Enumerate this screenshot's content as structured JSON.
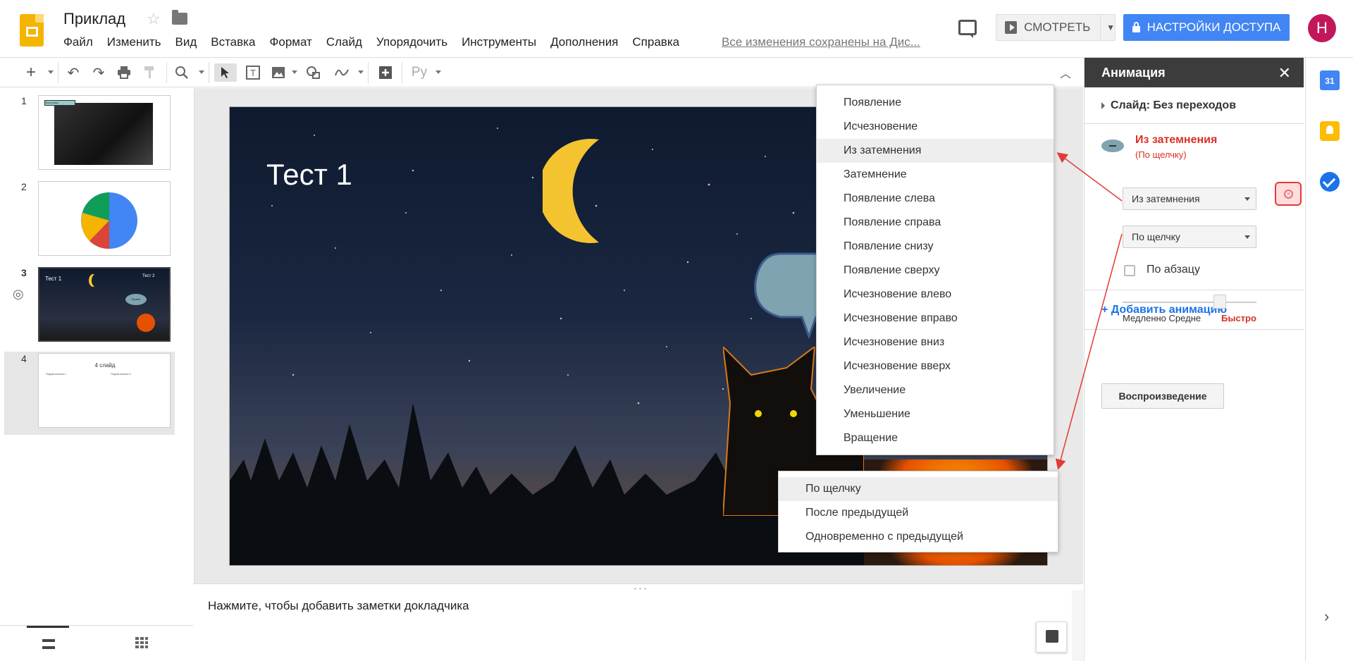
{
  "app": {
    "title": "Приклад",
    "save_status": "Все изменения сохранены на Дис...",
    "menu": [
      "Файл",
      "Изменить",
      "Вид",
      "Вставка",
      "Формат",
      "Слайд",
      "Упорядочить",
      "Инструменты",
      "Дополнения",
      "Справка"
    ],
    "present_label": "СМОТРЕТЬ",
    "share_label": "НАСТРОЙКИ ДОСТУПА",
    "avatar_letter": "Н",
    "accent_color": "#4285f4",
    "avatar_color": "#c2185b"
  },
  "toolbar": {
    "language_label": "Ру",
    "icons": [
      "add-icon",
      "undo-icon",
      "redo-icon",
      "print-icon",
      "paint-format-icon",
      "zoom-icon",
      "select-icon",
      "text-box-icon",
      "image-icon",
      "shape-icon",
      "line-icon",
      "comment-add-icon",
      "collapse-icon"
    ]
  },
  "filmstrip": {
    "slides": [
      {
        "num": "1"
      },
      {
        "num": "2"
      },
      {
        "num": "3"
      },
      {
        "num": "4"
      }
    ],
    "thumb1_label": "Заголовок презентации",
    "thumb3_title": "Тест 1",
    "thumb3_title2": "Тест 2",
    "thumb3_bubble": "Привет",
    "thumb4_title": "4 слайд",
    "thumb4_sub1": "Подзаголовок 1",
    "thumb4_sub2": "Подзаголовок 2"
  },
  "slide": {
    "title": "Тест 1",
    "bubble_text": "П"
  },
  "notes": {
    "placeholder": "Нажмите, чтобы добавить заметки докладчика"
  },
  "animation_panel": {
    "title": "Анимация",
    "slide_transition": "Слайд: Без переходов",
    "item_title": "Из затемнения",
    "item_sub": "(По щелчку)",
    "effect_value": "Из затемнения",
    "trigger_value": "По щелчку",
    "by_paragraph_label": "По абзацу",
    "speed_slow": "Медленно",
    "speed_medium": "Средне",
    "speed_fast": "Быстро",
    "speed_level": 0.75,
    "add_animation": "+ Добавить анимацию",
    "play_button": "Воспроизведение"
  },
  "effect_menu": {
    "options": [
      "Появление",
      "Исчезновение",
      "Из затемнения",
      "Затемнение",
      "Появление слева",
      "Появление справа",
      "Появление снизу",
      "Появление сверху",
      "Исчезновение влево",
      "Исчезновение вправо",
      "Исчезновение вниз",
      "Исчезновение вверх",
      "Увеличение",
      "Уменьшение",
      "Вращение"
    ],
    "selected": "Из затемнения"
  },
  "trigger_menu": {
    "options": [
      "По щелчку",
      "После предыдущей",
      "Одновременно с предыдущей"
    ],
    "selected": "По щелчку"
  },
  "right_rail": {
    "calendar_label": "31",
    "icons": [
      "calendar-icon",
      "keep-icon",
      "tasks-icon",
      "expand-icon"
    ]
  }
}
